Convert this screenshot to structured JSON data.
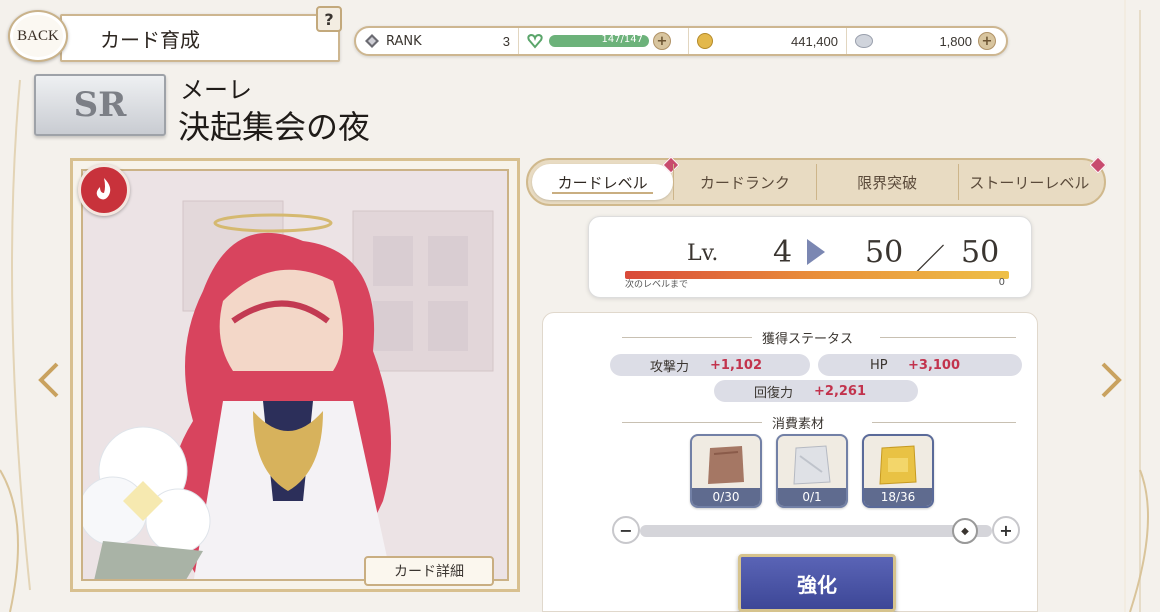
{
  "header": {
    "back_label": "BACK",
    "title": "カード育成",
    "help_label": "?"
  },
  "resources": {
    "rank_label": "RANK",
    "rank_value": "3",
    "stamina_text": "147/147",
    "stamina_fraction": 1.0,
    "coins": "441,400",
    "stones": "1,800",
    "plus": "+"
  },
  "card": {
    "rarity": "SR",
    "character_name": "メーレ",
    "title": "決起集会の夜",
    "detail_button": "カード詳細"
  },
  "tabs": [
    {
      "label": "カードレベル",
      "active": true
    },
    {
      "label": "カードランク",
      "active": false
    },
    {
      "label": "限界突破",
      "active": false
    },
    {
      "label": "ストーリーレベル",
      "active": false
    }
  ],
  "level": {
    "lv_label": "Lv.",
    "current": "4",
    "next": "50",
    "slash": "／",
    "max": "50",
    "exp_label": "次のレベルまで",
    "exp_value": "0"
  },
  "status": {
    "section_title": "獲得ステータス",
    "stats": [
      {
        "name": "攻撃力",
        "value": "+1,102"
      },
      {
        "name": "HP",
        "value": "+3,100"
      },
      {
        "name": "回復力",
        "value": "+2,261"
      }
    ]
  },
  "materials": {
    "section_title": "消費素材",
    "items": [
      {
        "count": "0/30"
      },
      {
        "count": "0/1"
      },
      {
        "count": "18/36"
      }
    ]
  },
  "controls": {
    "minus": "−",
    "plus": "+",
    "enhance": "強化"
  }
}
